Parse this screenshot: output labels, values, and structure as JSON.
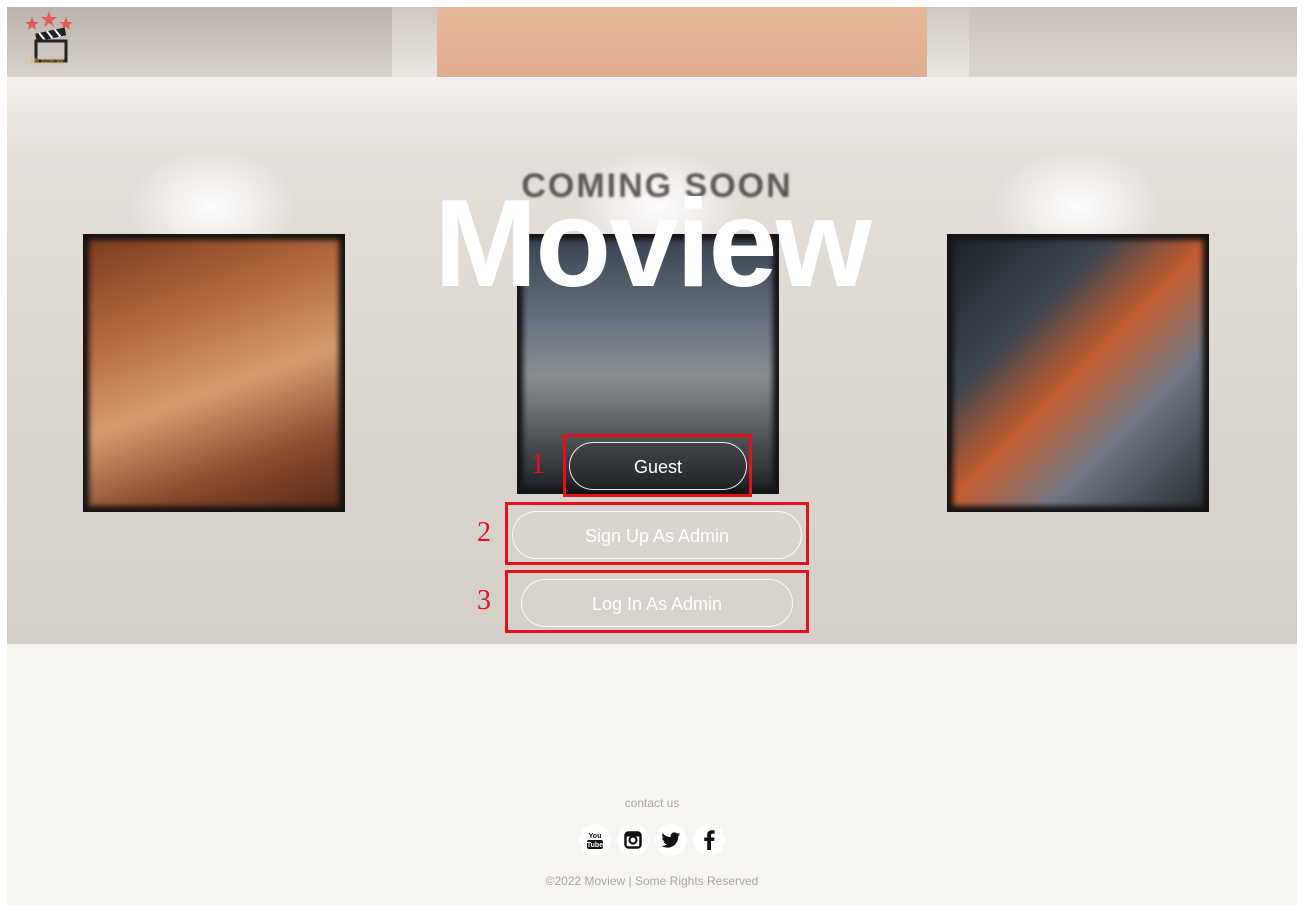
{
  "brand": {
    "logo_text": "MOVIEW",
    "title": "Moview"
  },
  "hero": {
    "sign_text": "COMING SOON"
  },
  "buttons": {
    "guest": "Guest",
    "signup_admin": "Sign Up As Admin",
    "login_admin": "Log In As Admin"
  },
  "annotations": {
    "n1": "1",
    "n2": "2",
    "n3": "3"
  },
  "footer": {
    "contact": "contact us",
    "socials": [
      "youtube-icon",
      "instagram-icon",
      "twitter-icon",
      "facebook-icon"
    ],
    "copyright": "©2022 Moview | Some Rights Reserved"
  },
  "colors": {
    "highlight": "#e5111a",
    "footer_bg": "#f7f5f2"
  }
}
